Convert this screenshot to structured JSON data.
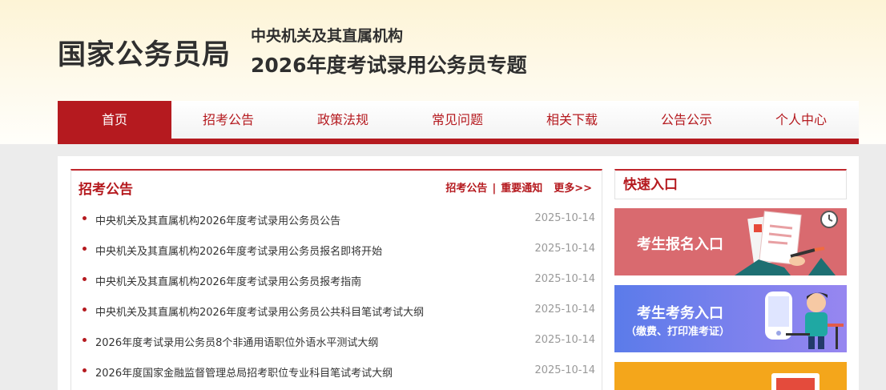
{
  "header": {
    "logo": "国家公务员局",
    "subtitle_line1": "中央机关及其直属机构",
    "subtitle_line2": "2026年度考试录用公务员专题"
  },
  "nav": {
    "items": [
      {
        "label": "首页",
        "active": true
      },
      {
        "label": "招考公告"
      },
      {
        "label": "政策法规"
      },
      {
        "label": "常见问题"
      },
      {
        "label": "相关下载"
      },
      {
        "label": "公告公示"
      },
      {
        "label": "个人中心"
      }
    ]
  },
  "announcements": {
    "title": "招考公告",
    "links": [
      "招考公告",
      "重要通知"
    ],
    "separator": "|",
    "more": "更多>>",
    "items": [
      {
        "title": "中央机关及其直属机构2026年度考试录用公务员公告",
        "date": "2025-10-14"
      },
      {
        "title": "中央机关及其直属机构2026年度考试录用公务员报名即将开始",
        "date": "2025-10-14"
      },
      {
        "title": "中央机关及其直属机构2026年度考试录用公务员报考指南",
        "date": "2025-10-14"
      },
      {
        "title": "中央机关及其直属机构2026年度考试录用公务员公共科目笔试考试大纲",
        "date": "2025-10-14"
      },
      {
        "title": "2026年度考试录用公务员8个非通用语职位外语水平测试大纲",
        "date": "2025-10-14"
      },
      {
        "title": "2026年度国家金融监督管理总局招考职位专业科目笔试考试大纲",
        "date": "2025-10-14"
      }
    ]
  },
  "quick": {
    "title": "快速入口",
    "entries": [
      {
        "label": "考生报名入口",
        "icon": "document-pen-icon"
      },
      {
        "label": "考生考务入口",
        "sub": "（缴费、打印准考证）",
        "icon": "person-computer-icon"
      },
      {
        "icon": "laptop-icon"
      }
    ]
  },
  "colors": {
    "brand_red": "#b51a1f",
    "entry_red": "#d96a6f",
    "entry_blue": "#5b7bea",
    "entry_orange": "#f4a61b"
  }
}
